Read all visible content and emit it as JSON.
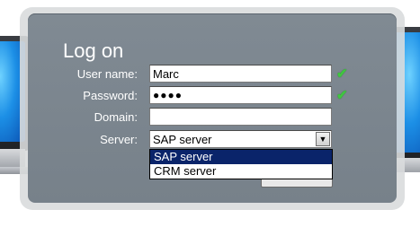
{
  "dialog": {
    "title": "Log on",
    "fields": {
      "username": {
        "label": "User name:",
        "value": "Marc",
        "valid": true
      },
      "password": {
        "label": "Password:",
        "value": "●●●●",
        "valid": true
      },
      "domain": {
        "label": "Domain:",
        "value": ""
      },
      "server": {
        "label": "Server:",
        "value": "SAP server",
        "options": [
          "SAP server",
          "CRM server"
        ],
        "highlighted_option": "SAP server"
      }
    },
    "icons": {
      "username_valid": "checkmark-icon",
      "password_valid": "checkmark-icon",
      "dropdown_arrow": "dropdown-arrow-icon"
    },
    "check_glyph": "✔",
    "arrow_glyph": "▼"
  },
  "colors": {
    "dialog_bg": "#78828b",
    "selected_option_bg": "#0a246a",
    "check_color": "#3fc63f"
  }
}
